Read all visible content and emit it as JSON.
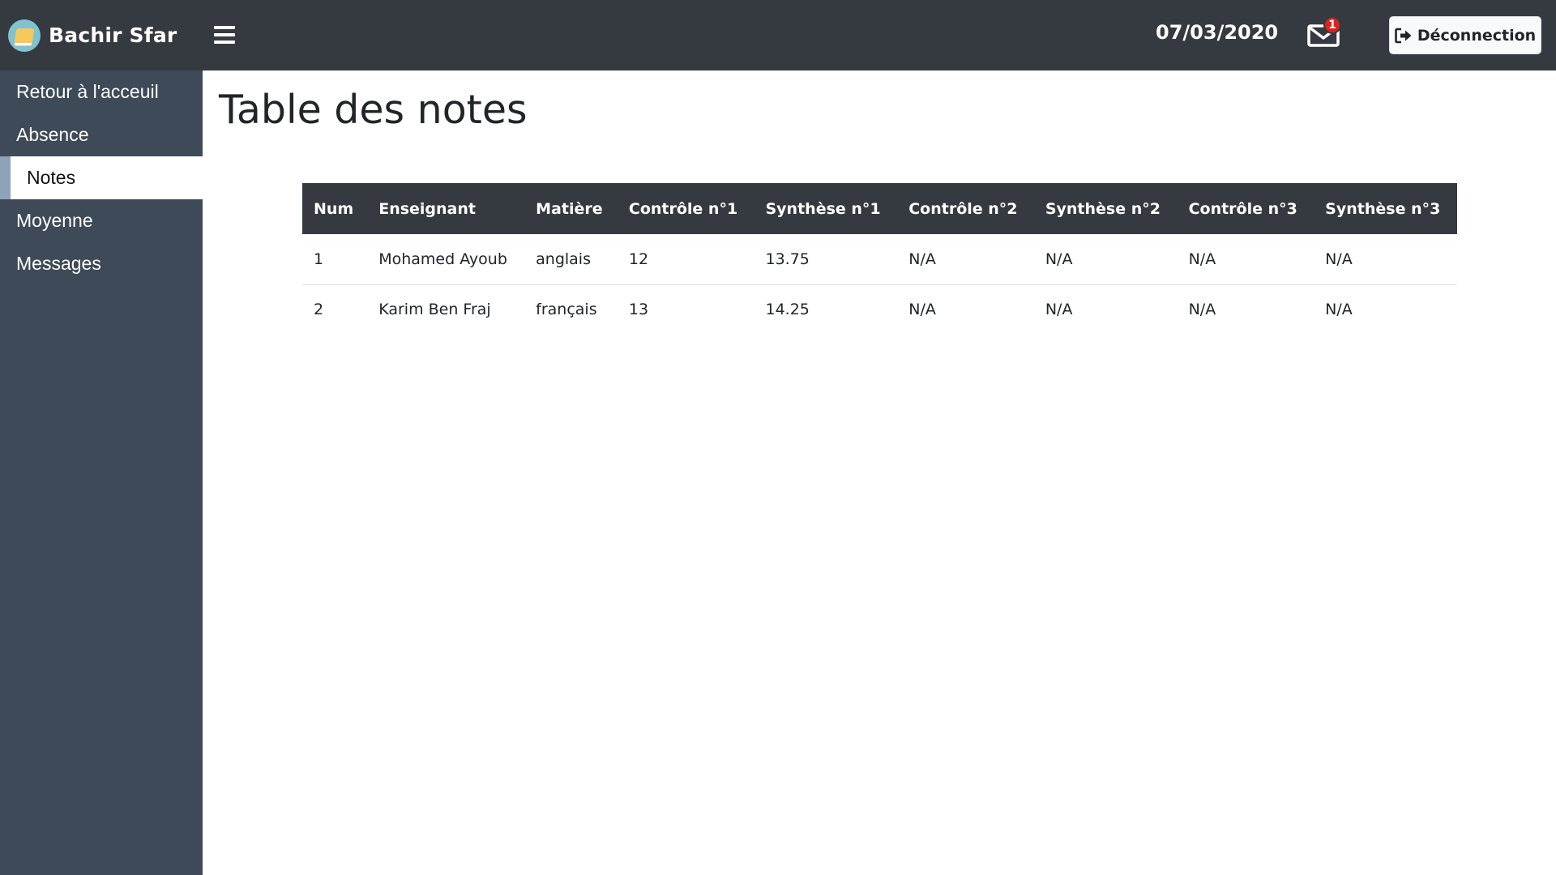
{
  "header": {
    "brand_name": "Bachir Sfar",
    "date": "07/03/2020",
    "mail_badge": "1",
    "logout_label": "Déconnection"
  },
  "sidebar": {
    "items": [
      {
        "label": "Retour à l'acceuil",
        "active": false
      },
      {
        "label": "Absence",
        "active": false
      },
      {
        "label": "Notes",
        "active": true
      },
      {
        "label": "Moyenne",
        "active": false
      },
      {
        "label": "Messages",
        "active": false
      }
    ]
  },
  "main": {
    "title": "Table des notes",
    "table": {
      "columns": [
        "Num",
        "Enseignant",
        "Matière",
        "Contrôle n°1",
        "Synthèse n°1",
        "Contrôle n°2",
        "Synthèse n°2",
        "Contrôle n°3",
        "Synthèse n°3"
      ],
      "rows": [
        [
          "1",
          "Mohamed Ayoub",
          "anglais",
          "12",
          "13.75",
          "N/A",
          "N/A",
          "N/A",
          "N/A"
        ],
        [
          "2",
          "Karim Ben Fraj",
          "français",
          "13",
          "14.25",
          "N/A",
          "N/A",
          "N/A",
          "N/A"
        ]
      ]
    }
  },
  "icons": {
    "brand": "book-logo-icon",
    "menu": "hamburger-menu-icon",
    "mail": "envelope-icon",
    "logout": "sign-out-icon"
  },
  "colors": {
    "topbar": "#343a40",
    "sidebar": "#3e4a58",
    "badge": "#d9251c",
    "active_indicator": "#8fa3b8"
  }
}
